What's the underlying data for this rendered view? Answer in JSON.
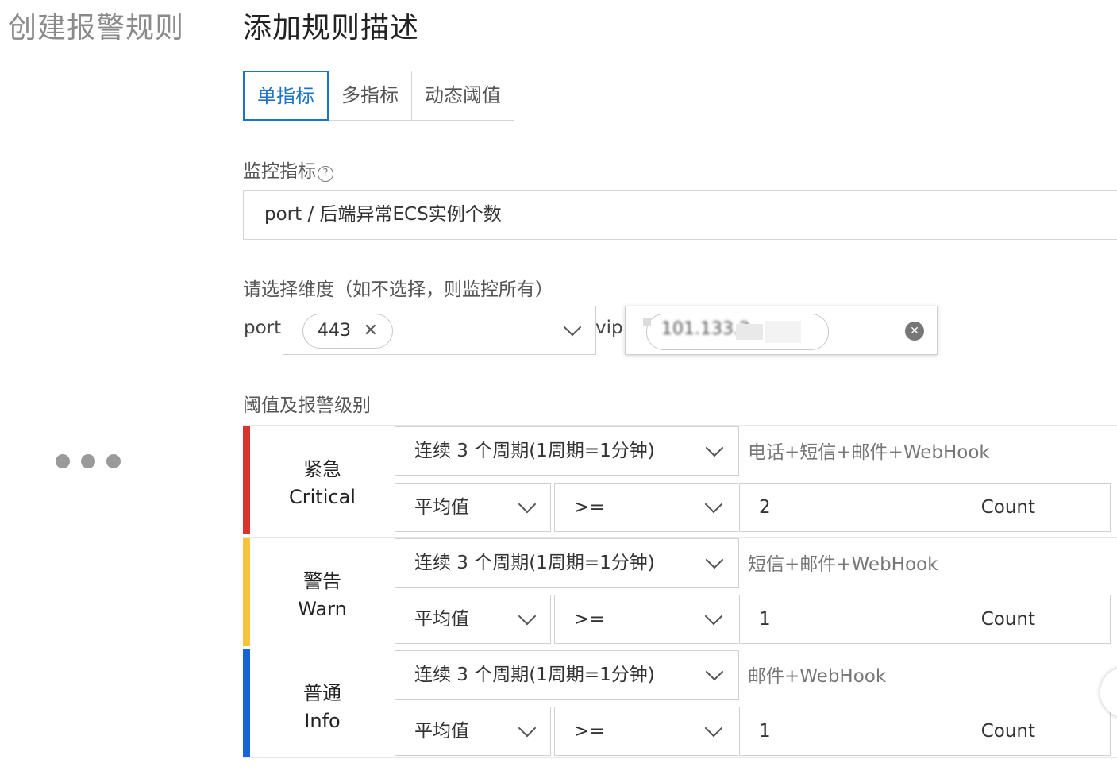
{
  "header": {
    "left_title": "创建报警规则",
    "right_title": "添加规则描述"
  },
  "tabs": [
    {
      "label": "单指标",
      "active": true
    },
    {
      "label": "多指标",
      "active": false
    },
    {
      "label": "动态阈值",
      "active": false
    }
  ],
  "metric": {
    "label": "监控指标",
    "help_glyph": "?",
    "value": "port / 后端异常ECS实例个数"
  },
  "dimensions": {
    "label": "请选择维度（如不选择，则监控所有）",
    "port_label": "port:",
    "port_tag": "443",
    "vip_label": "vip:",
    "vip_tag": "101.133.2"
  },
  "thresholds": {
    "label": "阈值及报警级别",
    "levels": [
      {
        "name_cn": "紧急",
        "name_en": "Critical",
        "color": "#d9342b",
        "period": "连续 3 个周期(1周期=1分钟)",
        "notify": "电话+短信+邮件+WebHook",
        "stat": "平均值",
        "op": ">=",
        "value": "2",
        "unit": "Count"
      },
      {
        "name_cn": "警告",
        "name_en": "Warn",
        "color": "#f7c23c",
        "period": "连续 3 个周期(1周期=1分钟)",
        "notify": "短信+邮件+WebHook",
        "stat": "平均值",
        "op": ">=",
        "value": "1",
        "unit": "Count"
      },
      {
        "name_cn": "普通",
        "name_en": "Info",
        "color": "#1565d8",
        "period": "连续 3 个周期(1周期=1分钟)",
        "notify": "邮件+WebHook",
        "stat": "平均值",
        "op": ">=",
        "value": "1",
        "unit": "Count"
      }
    ]
  },
  "colors": {
    "accent": "#1a73c8",
    "critical": "#d9342b",
    "warn": "#f7c23c",
    "info": "#1565d8"
  }
}
